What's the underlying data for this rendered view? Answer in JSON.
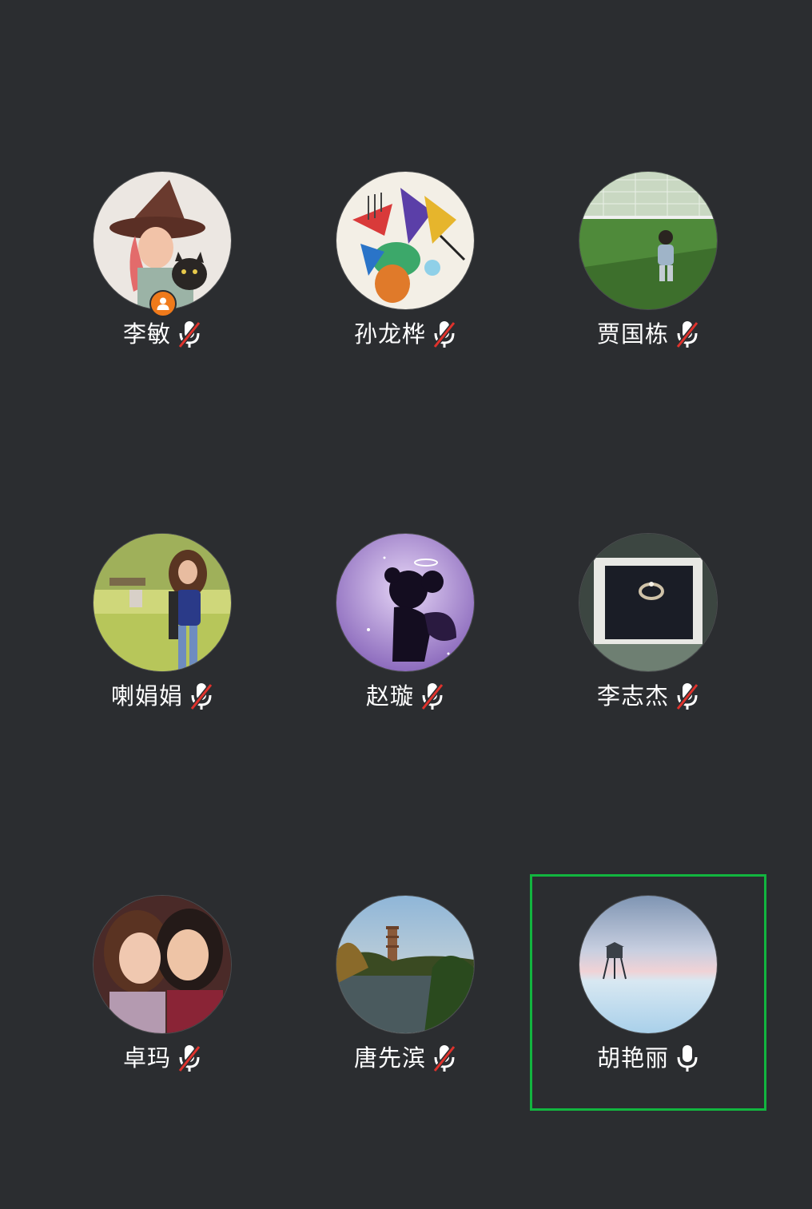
{
  "participants": [
    {
      "name": "李敏",
      "muted": true,
      "host": true,
      "avatar_icon": "witch-cat-avatar"
    },
    {
      "name": "孙龙桦",
      "muted": true,
      "host": false,
      "avatar_icon": "colorful-drawing-avatar"
    },
    {
      "name": "贾国栋",
      "muted": true,
      "host": false,
      "avatar_icon": "child-on-field-avatar"
    },
    {
      "name": "喇娟娟",
      "muted": true,
      "host": false,
      "avatar_icon": "woman-in-park-avatar"
    },
    {
      "name": "赵璇",
      "muted": true,
      "host": false,
      "avatar_icon": "purple-silhouette-avatar"
    },
    {
      "name": "李志杰",
      "muted": true,
      "host": false,
      "avatar_icon": "ring-box-avatar"
    },
    {
      "name": "卓玛",
      "muted": true,
      "host": false,
      "avatar_icon": "two-women-avatar"
    },
    {
      "name": "唐先滨",
      "muted": true,
      "host": false,
      "avatar_icon": "lake-pagoda-avatar"
    },
    {
      "name": "胡艳丽",
      "muted": false,
      "host": false,
      "speaking": true,
      "avatar_icon": "lighthouse-sea-avatar"
    }
  ],
  "colors": {
    "background": "#2b2d30",
    "speaking_border": "#12b53f",
    "host_badge": "#f07a1b",
    "mute_slash": "#e0322c"
  }
}
